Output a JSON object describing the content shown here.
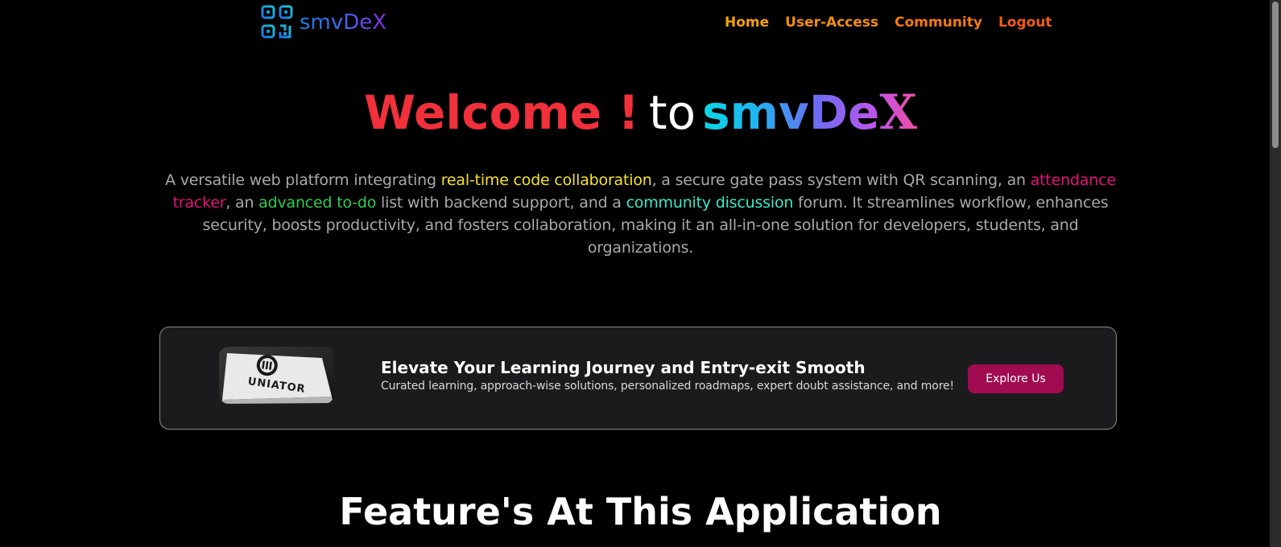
{
  "header": {
    "logo_text": "smvDeX",
    "logo_icon": "qr-code-icon",
    "nav": [
      {
        "label": "Home",
        "color": "#f5a010"
      },
      {
        "label": "User-Access",
        "color": "#f58e10"
      },
      {
        "label": "Community",
        "color": "#f57a10"
      },
      {
        "label": "Logout",
        "color": "#f25c12"
      }
    ]
  },
  "hero": {
    "welcome": "Welcome !",
    "to": "to",
    "brand_main": "smvDe",
    "brand_x": "X",
    "description": {
      "p1": "A versatile web platform integrating ",
      "h1": "real-time code collaboration",
      "p2": ", a secure gate pass system with QR scanning, an ",
      "h2": "attendance tracker",
      "p3": ", an ",
      "h3": "advanced to-do",
      "p4": " list with backend support, and a ",
      "h4": "community discussion",
      "p5": " forum. It streamlines workflow, enhances security, boosts productivity, and fosters collaboration, making it an all-in-one solution for developers, students, and organizations."
    }
  },
  "banner": {
    "image_text": "UNIATOR",
    "heading": "Elevate Your Learning Journey and Entry-exit Smooth",
    "subtext": "Curated learning, approach-wise solutions, personalized roadmaps, expert doubt assistance, and more!",
    "button_label": "Explore Us"
  },
  "features": {
    "heading": "Feature's At This Application"
  },
  "colors": {
    "background": "#000000",
    "welcome": "#f0303a",
    "highlight_yellow": "#f3e22a",
    "highlight_pink": "#e5117a",
    "highlight_green": "#2ecc52",
    "highlight_teal": "#3de8c8",
    "button": "#a00c4f"
  }
}
